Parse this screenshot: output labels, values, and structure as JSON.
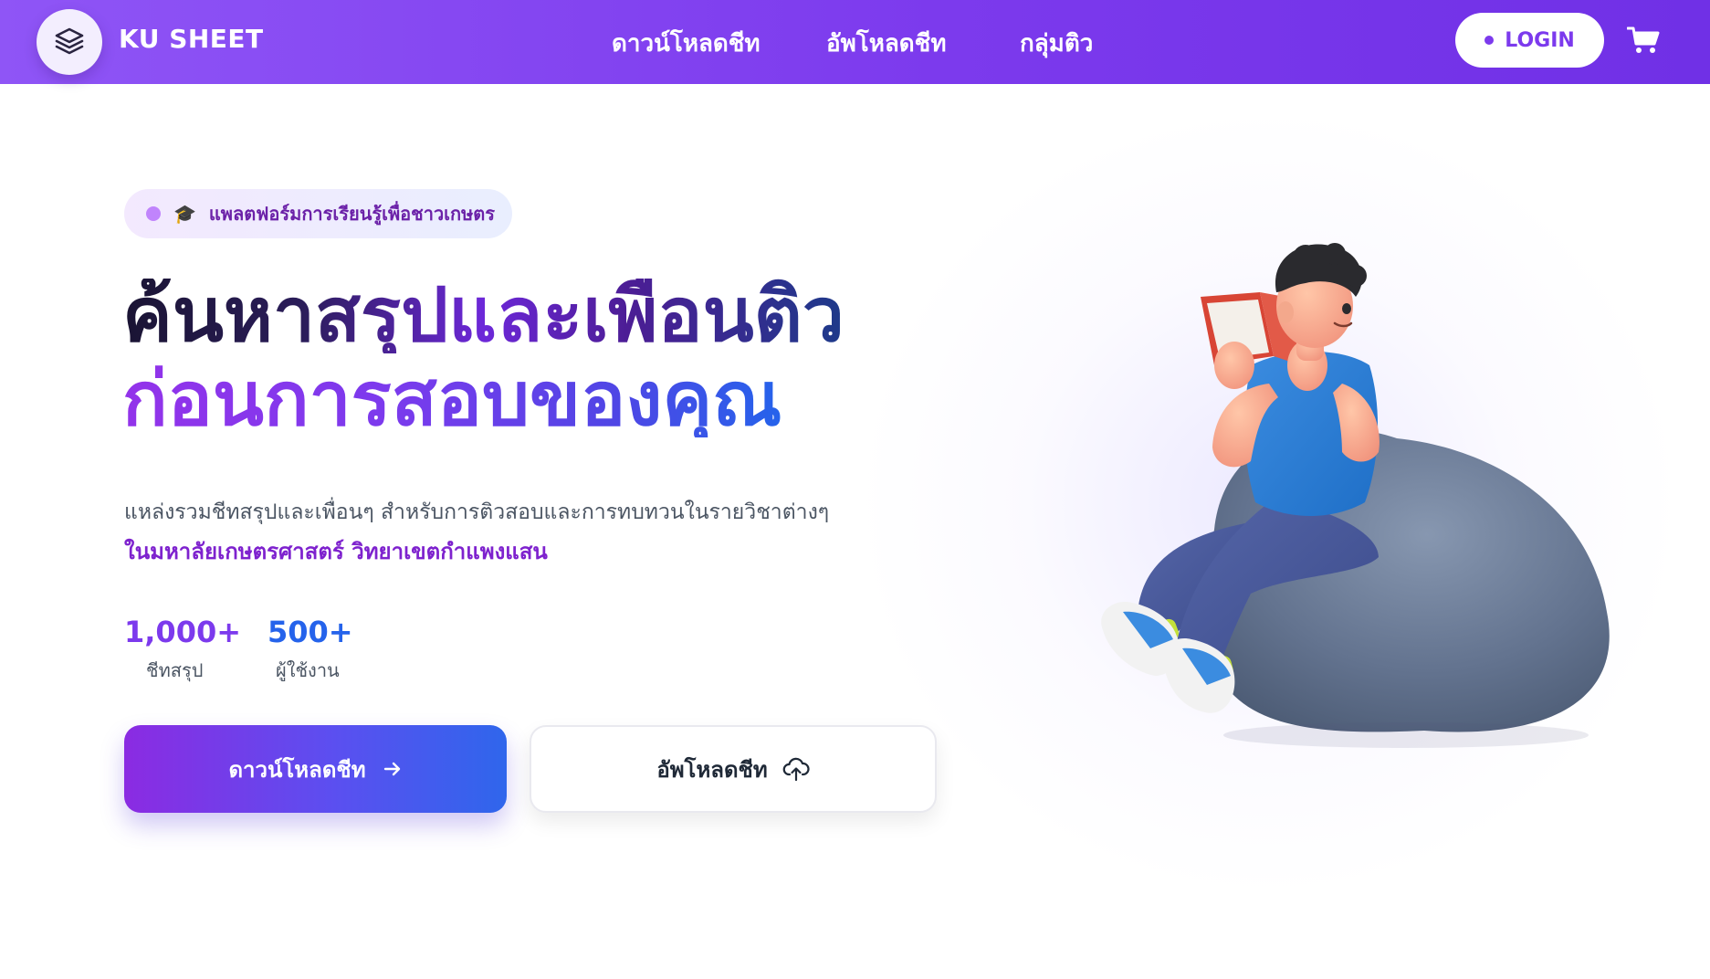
{
  "nav": {
    "brand": "KU SHEET",
    "links": [
      {
        "label": "ดาวน์โหลดชีท"
      },
      {
        "label": "อัพโหลดชีท"
      },
      {
        "label": "กลุ่มติว"
      }
    ],
    "login_label": "LOGIN",
    "logo_icon": "layers-stack-icon",
    "cart_icon": "shopping-cart-icon"
  },
  "hero": {
    "badge_icon": "graduation-cap-icon",
    "badge": "แพลตฟอร์มการเรียนรู้เพื่อชาวเกษตร",
    "headline_line1": "ค้นหาสรุปและเพื่อนติว",
    "headline_line2": "ก่อนการสอบของคุณ",
    "description": "แหล่งรวมชีทสรุปและเพื่อนๆ สำหรับการติวสอบและการทบทวนในรายวิชาต่างๆ",
    "description_highlight": "ในมหาลัยเกษตรศาสตร์ วิทยาเขตกำแพงแสน",
    "stats": [
      {
        "value": "1,000+",
        "label": "ชีทสรุป",
        "color": "#7c3aed"
      },
      {
        "value": "500+",
        "label": "ผู้ใช้งาน",
        "color": "#2563eb"
      }
    ],
    "primary_button": "ดาวน์โหลดชีท",
    "secondary_button": "อัพโหลดชีท",
    "illustration_icon": "student-reading-on-beanbag-illustration"
  },
  "colors": {
    "accent": "#7c3aed",
    "accent_blue": "#2563eb"
  }
}
